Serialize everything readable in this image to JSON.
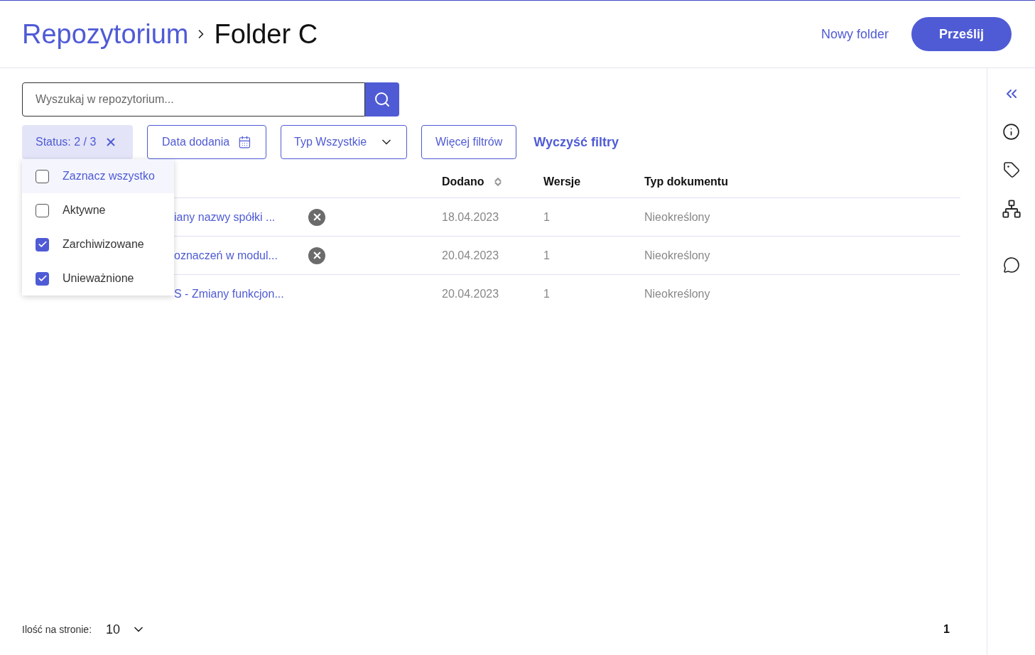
{
  "breadcrumb": [
    {
      "label": "Repozytorium",
      "current": false
    },
    {
      "label": "Folder C",
      "current": true
    }
  ],
  "header_actions": {
    "new_folder": "Nowy folder",
    "upload": "Prześlij"
  },
  "search": {
    "placeholder": "Wyszukaj w repozytorium..."
  },
  "filters": [
    {
      "kind": "status",
      "label": "Status: 2 / 3",
      "expanded": true
    },
    {
      "kind": "date",
      "label": "Data dodania"
    },
    {
      "kind": "select",
      "label": "Typ Wszystkie"
    },
    {
      "kind": "more",
      "label": "Więcej filtrów"
    }
  ],
  "clear_filters": "Wyczyść filtry",
  "status_menu": [
    {
      "label": "Zaznacz wszystko",
      "checked": false,
      "highlighted": true
    },
    {
      "label": "Aktywne",
      "checked": false,
      "highlighted": false
    },
    {
      "label": "Zarchiwizowane",
      "checked": true,
      "highlighted": false
    },
    {
      "label": "Unieważnione",
      "checked": true,
      "highlighted": false
    }
  ],
  "table": {
    "columns": [
      {
        "label": "Dodano",
        "sortable": true
      },
      {
        "label": "Wersje",
        "sortable": false
      },
      {
        "label": "Typ dokumentu",
        "sortable": false
      }
    ],
    "rows": [
      {
        "name": "iany nazwy spółki ...",
        "cancelled": true,
        "added": "18.04.2023",
        "versions": "1",
        "type": "Nieokreślony"
      },
      {
        "name": "oznaczeń w modul...",
        "cancelled": true,
        "added": "20.04.2023",
        "versions": "1",
        "type": "Nieokreślony"
      },
      {
        "name": "S - Zmiany funkcjon...",
        "cancelled": false,
        "added": "20.04.2023",
        "versions": "1",
        "type": "Nieokreślony"
      }
    ]
  },
  "pagination": {
    "per_page_label": "Ilość na stronie:",
    "per_page": "10",
    "pages": [
      {
        "label": "1",
        "selected": true
      }
    ]
  }
}
